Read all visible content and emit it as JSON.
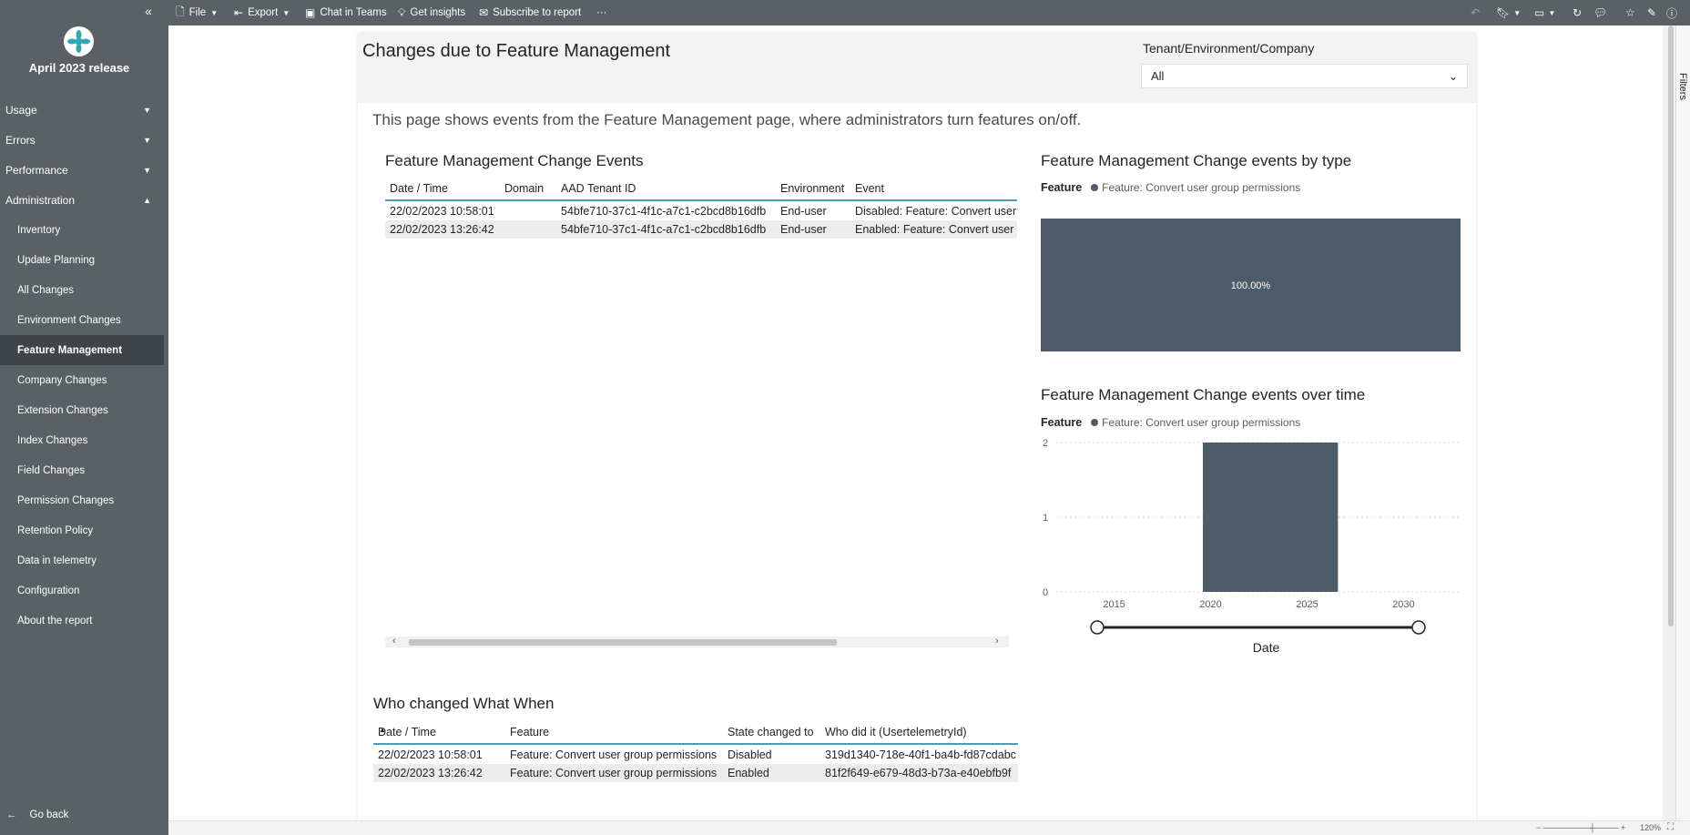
{
  "sidebar": {
    "collapse_label": "«",
    "release_title": "April 2023 release",
    "groups": [
      {
        "label": "Usage",
        "chevron": "⌄"
      },
      {
        "label": "Errors",
        "chevron": "⌄"
      },
      {
        "label": "Performance",
        "chevron": "⌄"
      },
      {
        "label": "Administration",
        "chevron": "⌃"
      }
    ],
    "admin_items": [
      "Inventory",
      "Update Planning",
      "All Changes",
      "Environment Changes",
      "Feature Management",
      "Company Changes",
      "Extension Changes",
      "Index Changes",
      "Field Changes",
      "Permission Changes",
      "Retention Policy",
      "Data in telemetry",
      "Configuration",
      "About the report"
    ],
    "active_item": "Feature Management",
    "go_back": "Go back"
  },
  "toolbar": {
    "file": "File",
    "export": "Export",
    "chat": "Chat in Teams",
    "insights": "Get insights",
    "subscribe": "Subscribe to report",
    "more": "···"
  },
  "report": {
    "title": "Changes due to Feature Management",
    "slicer_label": "Tenant/Environment/Company",
    "slicer_value": "All",
    "description": "This page shows events from the Feature Management page, where administrators turn features on/off."
  },
  "events_table": {
    "title": "Feature Management Change Events",
    "columns": [
      "Date / Time",
      "Domain",
      "AAD Tenant ID",
      "Environment",
      "Event"
    ],
    "rows": [
      [
        "22/02/2023 10:58:01",
        "",
        "54bfe710-37c1-4f1c-a7c1-c2bcd8b16dfb",
        "End-user",
        "Disabled: Feature: Convert user group permissions"
      ],
      [
        "22/02/2023 13:26:42",
        "",
        "54bfe710-37c1-4f1c-a7c1-c2bcd8b16dfb",
        "End-user",
        "Enabled: Feature: Convert user group permissions"
      ]
    ]
  },
  "who_table": {
    "title": "Who changed What When",
    "columns": [
      "Date / Time",
      "Feature",
      "State changed to",
      "Who did it (UsertelemetryId)"
    ],
    "rows": [
      [
        "22/02/2023 10:58:01",
        "Feature: Convert user group permissions",
        "Disabled",
        "319d1340-718e-40f1-ba4b-fd87cdabc"
      ],
      [
        "22/02/2023 13:26:42",
        "Feature: Convert user group permissions",
        "Enabled",
        "81f2f649-e679-48d3-b73a-e40ebfb9f"
      ]
    ]
  },
  "chart_data": [
    {
      "type": "bar",
      "title": "Feature Management Change events by type",
      "legend_title": "Feature",
      "series": [
        {
          "name": "Feature: Convert user group permissions",
          "values": [
            100.0
          ]
        }
      ],
      "data_labels": [
        "100.00%"
      ],
      "color": "#4e5b6b"
    },
    {
      "type": "bar",
      "title": "Feature Management Change events over time",
      "legend_title": "Feature",
      "xlabel": "Date",
      "x_ticks": [
        "2015",
        "2020",
        "2025",
        "2030"
      ],
      "y_ticks": [
        "0",
        "1",
        "2"
      ],
      "xlim": [
        2012,
        2033
      ],
      "ylim": [
        0,
        2
      ],
      "bars": [
        {
          "x_start": 2019.6,
          "x_end": 2026.6,
          "value": 2
        }
      ],
      "series": [
        {
          "name": "Feature: Convert user group permissions"
        }
      ],
      "color": "#4e5b6b",
      "grid": true
    }
  ],
  "statusbar": {
    "zoom": "120%"
  }
}
